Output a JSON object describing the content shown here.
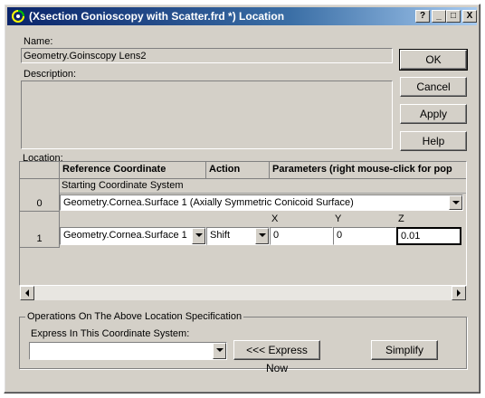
{
  "window": {
    "title": "(Xsection Gonioscopy with Scatter.frd *) Location",
    "controls": [
      "?",
      "_",
      "□",
      "X"
    ]
  },
  "name_label": "Name:",
  "name_value": "Geometry.Goinscopy Lens2",
  "description_label": "Description:",
  "buttons": {
    "ok": "OK",
    "cancel": "Cancel",
    "apply": "Apply",
    "help": "Help"
  },
  "location_label": "Location:",
  "grid": {
    "headers": [
      "Reference Coordinate",
      "Action",
      "Parameters (right mouse-click for pop"
    ],
    "row0": {
      "index": "0",
      "caption": "Starting Coordinate System",
      "value": "Geometry.Cornea.Surface 1   (Axially Symmetric Conicoid Surface)"
    },
    "row1": {
      "index": "1",
      "reference": "Geometry.Cornea.Surface 1",
      "action": "Shift",
      "param_labels": [
        "X",
        "Y",
        "Z"
      ],
      "param_values": [
        "0",
        "0",
        "0.01"
      ]
    }
  },
  "operations": {
    "group_label": "Operations On The Above Location Specification",
    "express_label": "Express In This Coordinate System:",
    "express_value": "",
    "express_now": "<<< Express Now",
    "simplify": "Simplify"
  }
}
